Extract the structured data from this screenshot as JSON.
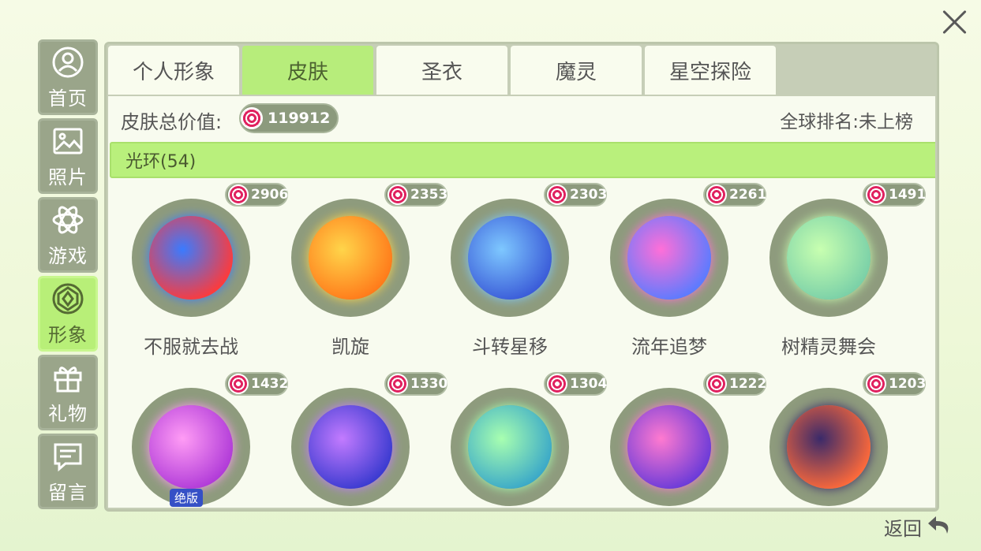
{
  "sidebar": {
    "items": [
      {
        "label": "首页",
        "icon": "user-circle-icon"
      },
      {
        "label": "照片",
        "icon": "photo-icon"
      },
      {
        "label": "游戏",
        "icon": "atom-icon"
      },
      {
        "label": "形象",
        "icon": "diamond-icon",
        "active": true
      },
      {
        "label": "礼物",
        "icon": "gift-icon"
      },
      {
        "label": "留言",
        "icon": "message-icon"
      }
    ]
  },
  "tabs": [
    {
      "label": "个人形象"
    },
    {
      "label": "皮肤",
      "active": true
    },
    {
      "label": "圣衣"
    },
    {
      "label": "魔灵"
    },
    {
      "label": "星空探险"
    }
  ],
  "info": {
    "total_label": "皮肤总价值:",
    "total_value": "119912",
    "rank_text": "全球排名:未上榜"
  },
  "category": {
    "label": "光环(54)"
  },
  "items": [
    {
      "name": "不服就去战",
      "price": "2906",
      "colors": [
        "#3a7bff",
        "#ff3a3a"
      ]
    },
    {
      "name": "凯旋",
      "price": "2353",
      "colors": [
        "#ffd54a",
        "#ff7a1a"
      ]
    },
    {
      "name": "斗转星移",
      "price": "2303",
      "colors": [
        "#7ec8ff",
        "#3a5bd8"
      ]
    },
    {
      "name": "流年追梦",
      "price": "2261",
      "colors": [
        "#ff6fd8",
        "#5a7bff"
      ]
    },
    {
      "name": "树精灵舞会",
      "price": "1491",
      "colors": [
        "#c8ffb0",
        "#7ad0a8"
      ]
    },
    {
      "name": "",
      "price": "1432",
      "colors": [
        "#ff9cf5",
        "#b03ad8"
      ],
      "badge": "绝版"
    },
    {
      "name": "",
      "price": "1330",
      "colors": [
        "#c37bff",
        "#3a3ad0"
      ]
    },
    {
      "name": "",
      "price": "1304",
      "colors": [
        "#a8ffb0",
        "#3aa8c8"
      ]
    },
    {
      "name": "",
      "price": "1222",
      "colors": [
        "#ff7ad0",
        "#6a3ad8"
      ]
    },
    {
      "name": "",
      "price": "1203",
      "colors": [
        "#3a2a6a",
        "#ff6a3a"
      ]
    }
  ],
  "footer": {
    "back_label": "返回"
  },
  "accent": {
    "active_green": "#b7ed7b",
    "plate": "#8e9b7d",
    "coin_red": "#e0215f"
  }
}
